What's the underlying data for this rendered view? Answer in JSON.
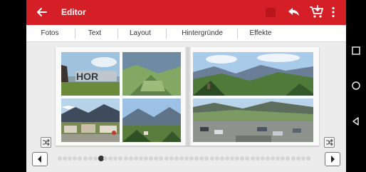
{
  "app": {
    "title": "Editor",
    "colors": {
      "brand": "#d51f26",
      "surface": "#ececec"
    }
  },
  "toolbar": {
    "icons": [
      "back-arrow-icon",
      "stop-icon",
      "undo-icon",
      "cart-icon",
      "more-vert-icon"
    ]
  },
  "tabs": [
    "Fotos",
    "Text",
    "Layout",
    "Hintergründe",
    "Effekte"
  ],
  "book": {
    "left_page_photos": [
      "sign-photo",
      "valley-photo",
      "town-photo",
      "mountain-village-photo"
    ],
    "right_page_photos": [
      "mountain-panorama-photo",
      "parking-lot-photo"
    ],
    "sign_text": "HOR"
  },
  "pager": {
    "page_count": 50,
    "current_page": 8
  },
  "system_nav": [
    "square-icon",
    "circle-icon",
    "triangle-icon"
  ]
}
